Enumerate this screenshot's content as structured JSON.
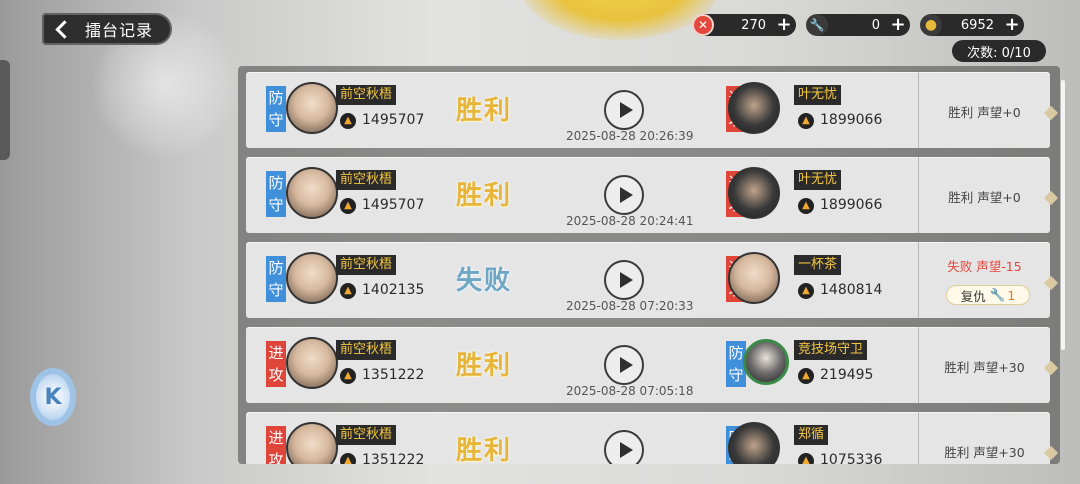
{
  "header": {
    "back_title": "擂台记录"
  },
  "currencies": [
    {
      "icon": "ticket-icon",
      "value": "270",
      "color": "#e4473c"
    },
    {
      "icon": "wrench-icon",
      "value": "0",
      "color": "#6aa0d8"
    },
    {
      "icon": "coin-icon",
      "value": "6952",
      "color": "#e8b93a"
    }
  ],
  "attempts": "次数: 0/10",
  "records": [
    {
      "left_role": "防守",
      "left_name": "前空秋梧",
      "left_power": "1495707",
      "result": "胜利",
      "time": "2025-08-28 20:26:39",
      "right_role": "进攻",
      "right_name": "叶无忧",
      "right_power": "1899066",
      "outcome": "胜利 声望+0"
    },
    {
      "left_role": "防守",
      "left_name": "前空秋梧",
      "left_power": "1495707",
      "result": "胜利",
      "time": "2025-08-28 20:24:41",
      "right_role": "进攻",
      "right_name": "叶无忧",
      "right_power": "1899066",
      "outcome": "胜利 声望+0"
    },
    {
      "left_role": "防守",
      "left_name": "前空秋梧",
      "left_power": "1402135",
      "result": "失败",
      "time": "2025-08-28 07:20:33",
      "right_role": "进攻",
      "right_name": "一杯茶",
      "right_power": "1480814",
      "outcome": "失败 声望-15",
      "revenge_label": "复仇",
      "revenge_count": "1"
    },
    {
      "left_role": "进攻",
      "left_name": "前空秋梧",
      "left_power": "1351222",
      "result": "胜利",
      "time": "2025-08-28 07:05:18",
      "right_role": "防守",
      "right_name": "竞技场守卫",
      "right_power": "219495",
      "outcome": "胜利 声望+30"
    },
    {
      "left_role": "进攻",
      "left_name": "前空秋梧",
      "left_power": "1351222",
      "result": "胜利",
      "time": "",
      "right_role": "防守",
      "right_name": "郑循",
      "right_power": "1075336",
      "outcome": "胜利 声望+30"
    }
  ]
}
